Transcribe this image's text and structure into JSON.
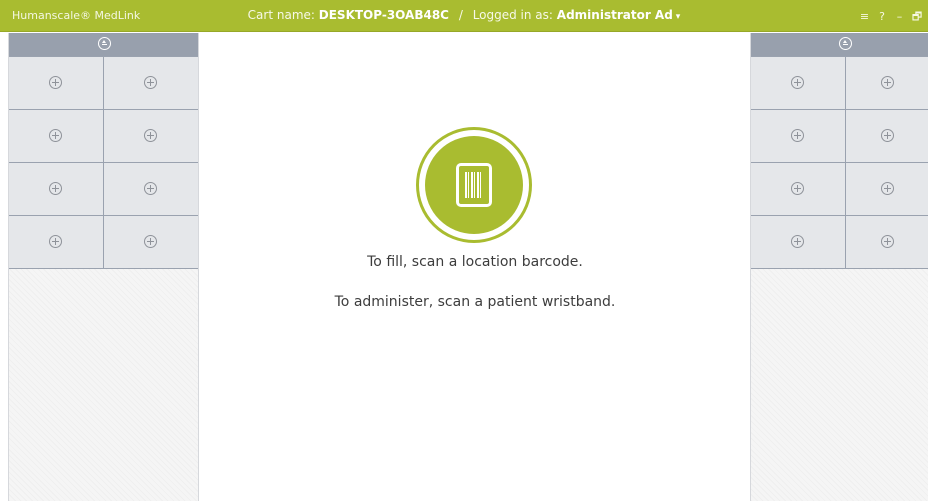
{
  "header": {
    "app_name": "Humanscale® MedLink",
    "cart_label": "Cart name:",
    "cart_name": "DESKTOP-3OAB48C",
    "separator": "/",
    "login_label": "Logged in as:",
    "user_name": "Administrator Ad",
    "user_caret": "▾",
    "controls": {
      "menu": "≡",
      "help": "?",
      "minimize": "–",
      "restore": "🗗"
    }
  },
  "left_drawer": {
    "bins": 8
  },
  "right_drawer": {
    "bins": 8
  },
  "main": {
    "fill_instruction": "To fill, scan a location barcode.",
    "administer_instruction": "To administer, scan a patient wristband."
  },
  "colors": {
    "accent": "#a9bc30",
    "drawer_header": "#98a0ad",
    "bin_background": "#e5e7ea"
  }
}
